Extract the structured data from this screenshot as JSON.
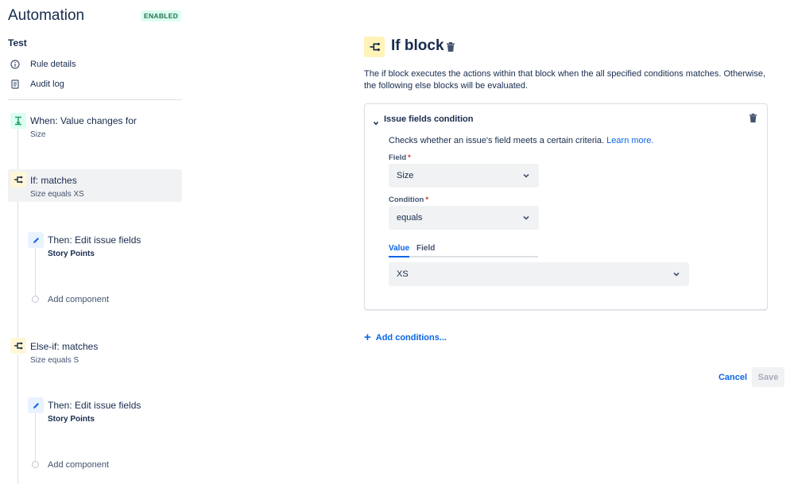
{
  "app": {
    "title": "Automation",
    "status_badge": "ENABLED"
  },
  "rule": {
    "name": "Test",
    "nav": [
      {
        "label": "Rule details",
        "icon": "info-icon"
      },
      {
        "label": "Audit log",
        "icon": "document-icon"
      }
    ]
  },
  "steps": {
    "trigger": {
      "title": "When: Value changes for",
      "sub": "Size",
      "icon": "trigger-icon"
    },
    "if_block": {
      "title": "If: matches",
      "sub": "Size equals XS",
      "icon": "branch-icon"
    },
    "then_1": {
      "title": "Then: Edit issue fields",
      "sub": "Story Points",
      "icon": "pencil-icon"
    },
    "add_1": {
      "label": "Add component"
    },
    "else_if": {
      "title": "Else-if: matches",
      "sub": "Size equals S",
      "icon": "branch-icon"
    },
    "then_2": {
      "title": "Then: Edit issue fields",
      "sub": "Story Points",
      "icon": "pencil-icon"
    },
    "add_2": {
      "label": "Add component"
    }
  },
  "panel": {
    "title": "If block",
    "description": "The if block executes the actions within that block when the all specified conditions matches. Otherwise, the following else blocks will be evaluated.",
    "condition": {
      "title": "Issue fields condition",
      "description": "Checks whether an issue's field meets a certain criteria.",
      "learn_more": "Learn more.",
      "field_label": "Field",
      "field_value": "Size",
      "condition_label": "Condition",
      "condition_value": "equals",
      "tabs": [
        "Value",
        "Field"
      ],
      "active_tab": "Value",
      "value": "XS",
      "required_mark": "*"
    },
    "add_conditions": "Add conditions...",
    "cancel": "Cancel",
    "save": "Save"
  },
  "colors": {
    "accent": "#0c66e4",
    "enabled_badge_bg": "#dcfff1",
    "enabled_badge_text": "#216e4e",
    "condition_icon_bg": "#fff3b8",
    "action_icon_bg": "#e9f2ff"
  }
}
